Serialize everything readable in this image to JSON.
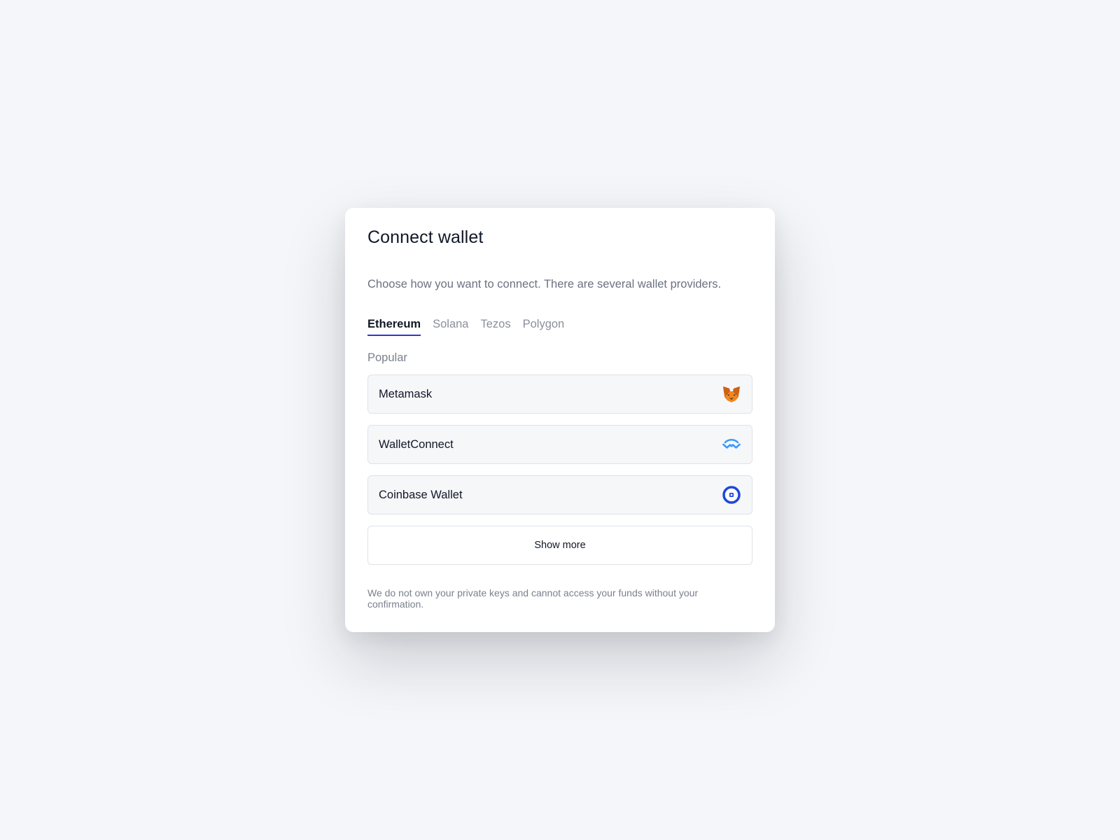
{
  "modal": {
    "title": "Connect wallet",
    "subtitle": "Choose how you want to connect. There are several wallet providers.",
    "tabs": [
      {
        "label": "Ethereum",
        "active": true
      },
      {
        "label": "Solana",
        "active": false
      },
      {
        "label": "Tezos",
        "active": false
      },
      {
        "label": "Polygon",
        "active": false
      }
    ],
    "section_label": "Popular",
    "wallets": [
      {
        "label": "Metamask",
        "icon": "metamask-fox-icon"
      },
      {
        "label": "WalletConnect",
        "icon": "walletconnect-icon"
      },
      {
        "label": "Coinbase Wallet",
        "icon": "coinbase-icon"
      }
    ],
    "show_more_label": "Show more",
    "disclaimer": "We do not own your private keys and cannot access your funds without your confirmation."
  },
  "colors": {
    "background": "#f5f6f9",
    "accent": "#2b38d8",
    "walletconnect_blue": "#3b99fc",
    "coinbase_blue": "#1f47d8",
    "metamask_orange": "#e2761b"
  }
}
